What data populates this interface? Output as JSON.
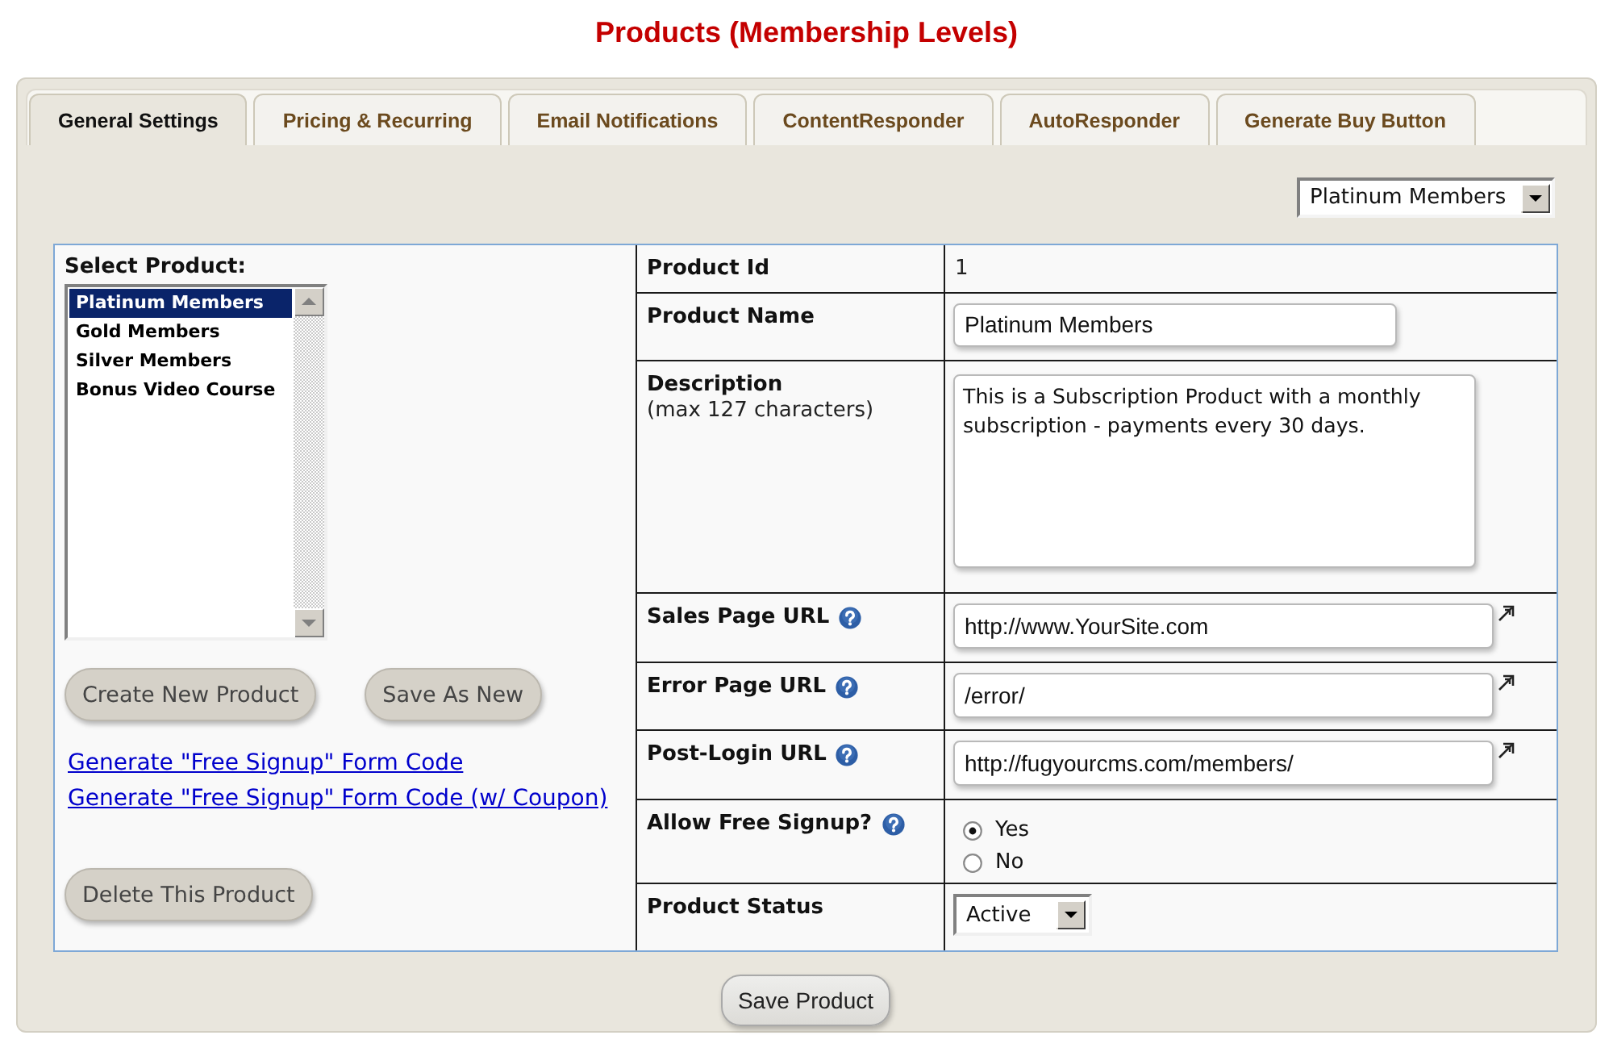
{
  "page": {
    "title": "Products (Membership Levels)"
  },
  "tabs": [
    {
      "label": "General Settings",
      "selected": true
    },
    {
      "label": "Pricing & Recurring",
      "selected": false
    },
    {
      "label": "Email Notifications",
      "selected": false
    },
    {
      "label": "ContentResponder",
      "selected": false
    },
    {
      "label": "AutoResponder",
      "selected": false
    },
    {
      "label": "Generate Buy Button",
      "selected": false
    }
  ],
  "product_picker": {
    "value": "Platinum Members"
  },
  "product_list": {
    "label": "Select Product:",
    "items": [
      {
        "label": "Platinum Members",
        "selected": true
      },
      {
        "label": "Gold Members",
        "selected": false
      },
      {
        "label": "Silver Members",
        "selected": false
      },
      {
        "label": "Bonus Video Course",
        "selected": false
      }
    ],
    "buttons": [
      "Create New Product",
      "Save As New"
    ],
    "links": [
      "Generate \"Free Signup\" Form Code",
      "Generate \"Free Signup\" Form Code (w/ Coupon)"
    ],
    "delete_button": "Delete This Product"
  },
  "fields": [
    {
      "kind": "text",
      "label": "Product Id",
      "help": false,
      "value": "1"
    },
    {
      "kind": "input",
      "label": "Product Name",
      "help": false,
      "value": "Platinum Members"
    },
    {
      "kind": "textarea",
      "label": "Description",
      "note": "(max 127 characters)",
      "help": false,
      "value": "This is a Subscription Product with a monthly subscription - payments every 30 days."
    },
    {
      "kind": "url",
      "label": "Sales Page URL",
      "help": true,
      "value": "http://www.YourSite.com"
    },
    {
      "kind": "url",
      "label": "Error Page URL",
      "help": true,
      "value": "/error/"
    },
    {
      "kind": "url",
      "label": "Post-Login URL",
      "help": true,
      "value": "http://fugyourcms.com/members/"
    },
    {
      "kind": "radio",
      "label": "Allow Free Signup?",
      "help": true,
      "options": [
        {
          "label": "Yes",
          "selected": true
        },
        {
          "label": "No",
          "selected": false
        }
      ]
    },
    {
      "kind": "select",
      "label": "Product Status",
      "help": false,
      "value": "Active"
    }
  ],
  "save_button": "Save Product"
}
